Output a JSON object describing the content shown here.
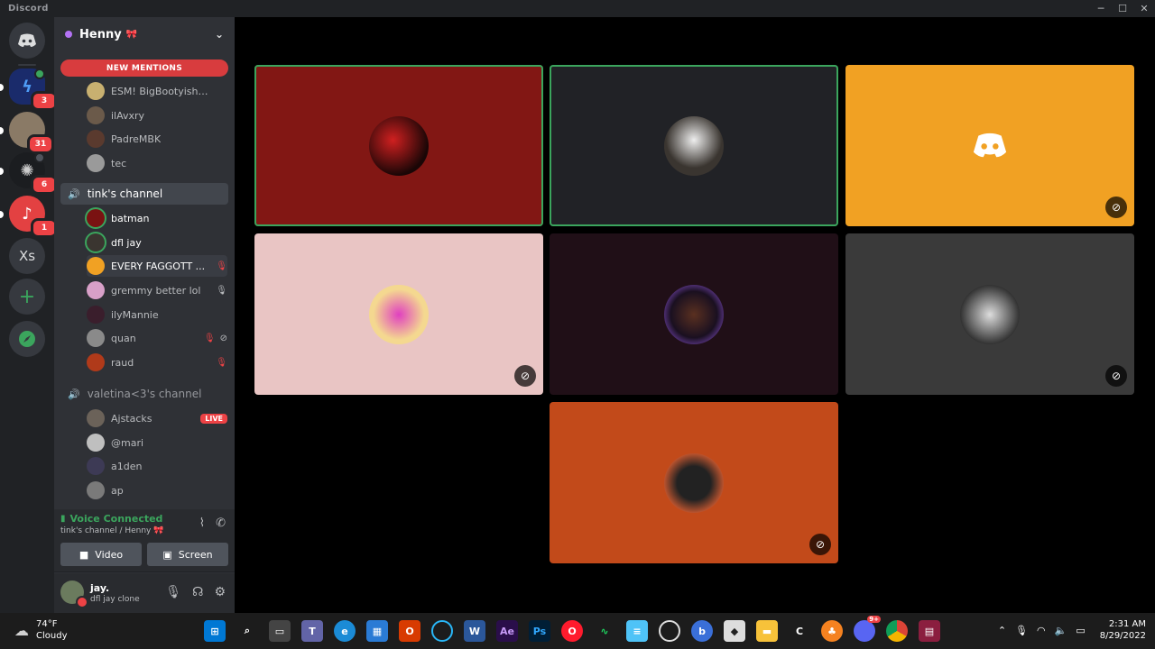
{
  "window": {
    "title": "Discord"
  },
  "rail": {
    "badges": {
      "srv1": "3",
      "srv2": "31",
      "srv3": "6",
      "srv4": "1"
    },
    "xs_label": "Xs",
    "add_label": "+"
  },
  "guild": {
    "name": "Henny",
    "emoji": "🎀"
  },
  "new_mentions": "NEW MENTIONS",
  "top_users": [
    {
      "name": "ESM! BigBootyisha🤍"
    },
    {
      "name": "ilAvxry"
    },
    {
      "name": "PadreMBK"
    },
    {
      "name": "tec"
    }
  ],
  "channel_tinks": {
    "name": "tink's channel",
    "users": [
      {
        "name": "batman"
      },
      {
        "name": "dfl jay"
      },
      {
        "name": "EVERY FAGGOTT ..."
      },
      {
        "name": "gremmy better lol"
      },
      {
        "name": "ilyMannie"
      },
      {
        "name": "quan"
      },
      {
        "name": "raud"
      }
    ]
  },
  "channel_valetina": {
    "name": "valetina<3's channel",
    "users": [
      {
        "name": "Ajstacks",
        "live": "LIVE"
      },
      {
        "name": "@mari"
      },
      {
        "name": "a1den"
      },
      {
        "name": "ap"
      }
    ]
  },
  "voice": {
    "status": "Voice Connected",
    "location": "tink's channel / Henny 🎀",
    "video_label": "Video",
    "screen_label": "Screen"
  },
  "user": {
    "name": "jay.",
    "status": "dfl jay clone"
  },
  "colors": {
    "accent_green": "#3ba55d",
    "danger_red": "#ed4245",
    "tile_red": "#821714",
    "tile_dark": "#212226",
    "tile_orange": "#f1a123",
    "tile_pink": "#e9c5c4",
    "tile_purple": "#200f17",
    "tile_gray": "#3a3a3a",
    "tile_rust": "#c24a1a"
  },
  "taskbar": {
    "temp": "74°F",
    "condition": "Cloudy",
    "time": "2:31 AM",
    "date": "8/29/2022",
    "discord_badge": "9+",
    "apps": [
      "windows-start",
      "search",
      "task-view",
      "teams",
      "edge",
      "store",
      "office",
      "cortana",
      "word",
      "after-effects",
      "photoshop",
      "opera",
      "music",
      "notepad",
      "obs",
      "blue-app",
      "roblox",
      "file-explorer",
      "ccleaner",
      "fl-studio",
      "discord",
      "chrome",
      "winrar"
    ]
  }
}
